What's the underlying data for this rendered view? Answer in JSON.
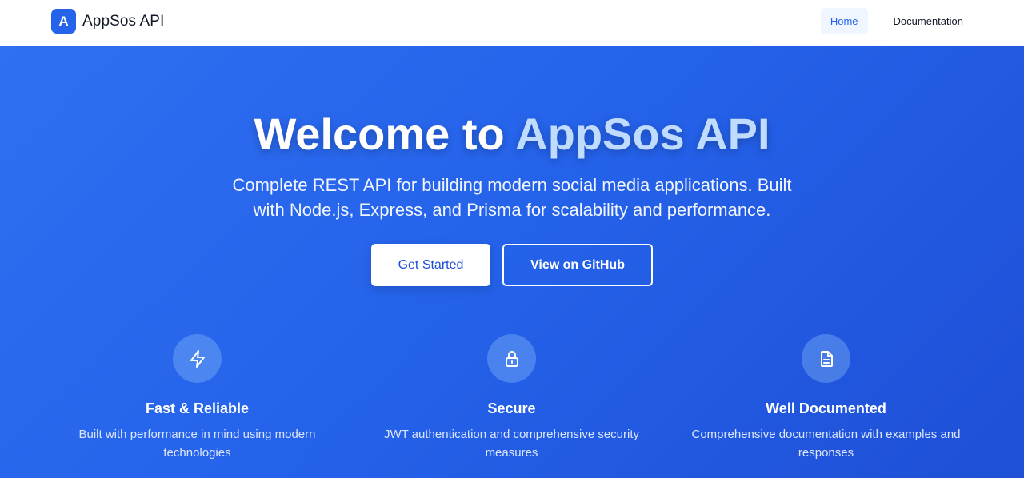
{
  "header": {
    "logo_letter": "A",
    "brand": "AppSos API",
    "nav": {
      "home": "Home",
      "documentation": "Documentation"
    }
  },
  "hero": {
    "title_prefix": "Welcome to ",
    "title_accent": "AppSos API",
    "tagline": "Complete REST API for building modern social media applications. Built with Node.js, Express, and Prisma for scalability and performance.",
    "get_started": "Get Started",
    "github": "View on GitHub"
  },
  "features": [
    {
      "icon": "lightning-icon",
      "title": "Fast & Reliable",
      "description": "Built with performance in mind using modern technologies"
    },
    {
      "icon": "lock-icon",
      "title": "Secure",
      "description": "JWT authentication and comprehensive security measures"
    },
    {
      "icon": "document-icon",
      "title": "Well Documented",
      "description": "Comprehensive documentation with examples and responses"
    }
  ],
  "colors": {
    "brand_blue": "#2563eb",
    "hero_gradient_start": "#2f6ff0",
    "hero_gradient_end": "#1e4fd6",
    "accent_text": "#bfdbfe"
  }
}
